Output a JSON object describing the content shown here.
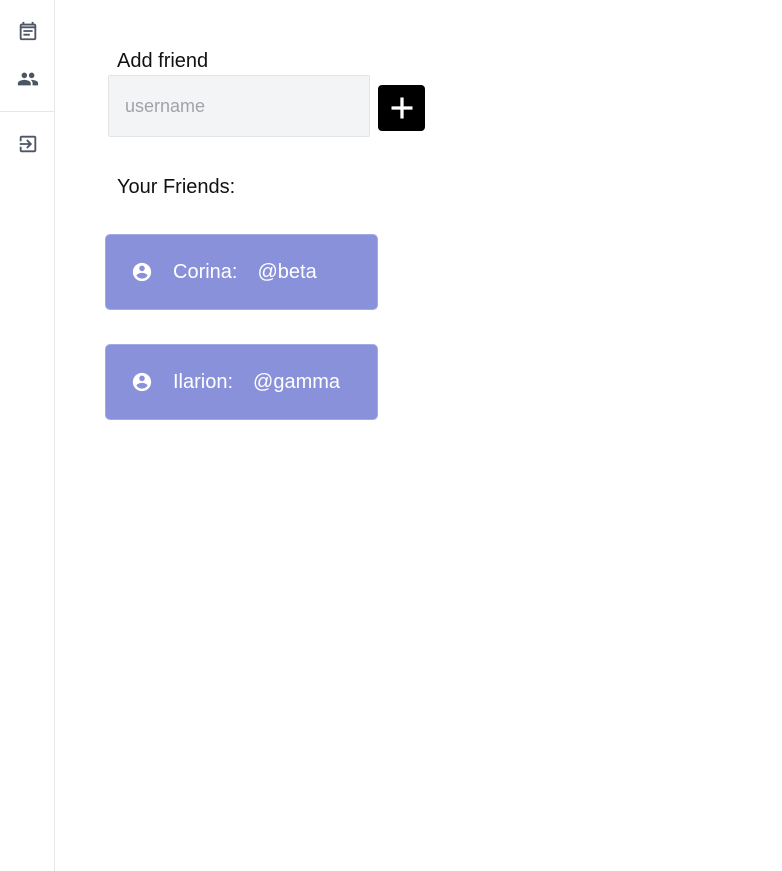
{
  "sidebar": {
    "items": [
      {
        "icon": "calendar-event-icon"
      },
      {
        "icon": "people-icon"
      },
      {
        "icon": "logout-icon"
      }
    ]
  },
  "add_friend": {
    "label": "Add friend",
    "input_placeholder": "username",
    "input_value": "",
    "button_icon": "plus-square-icon"
  },
  "friends": {
    "title": "Your Friends:",
    "list": [
      {
        "name": "Corina:",
        "handle": "@beta",
        "icon": "account-circle-icon"
      },
      {
        "name": "Ilarion:",
        "handle": "@gamma",
        "icon": "account-circle-icon"
      }
    ]
  },
  "colors": {
    "card_bg": "#8891d9",
    "add_button_bg": "#000000",
    "input_bg": "#f3f4f6"
  }
}
